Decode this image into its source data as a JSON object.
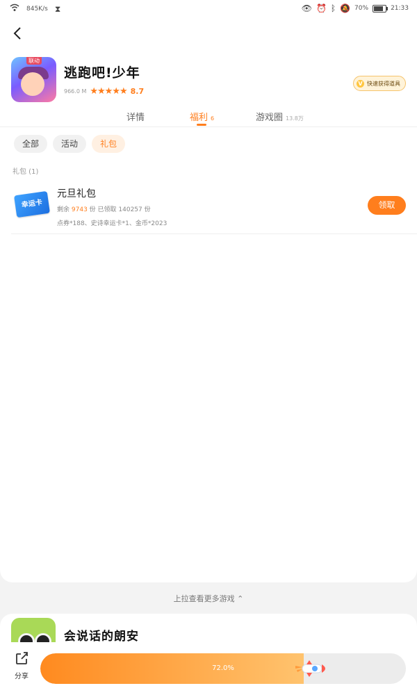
{
  "status_bar": {
    "net_speed": "845K/s",
    "battery": "70%",
    "time": "21:33"
  },
  "game": {
    "title": "逃跑吧!少年",
    "size": "966.0 M",
    "rating": "8.7",
    "rating_value": 4.5,
    "quick_tag": "快速获得道具",
    "icon_tag": "联动"
  },
  "tabs": [
    {
      "label": "详情",
      "count": ""
    },
    {
      "label": "福利",
      "count": "6"
    },
    {
      "label": "游戏圈",
      "count": "13.8万"
    }
  ],
  "chips": [
    "全部",
    "活动",
    "礼包"
  ],
  "section_label": "礼包 (1)",
  "gift": {
    "icon_text": "幸运卡",
    "title": "元旦礼包",
    "remain_prefix": "剩余",
    "remain": "9743",
    "remain_suffix": "份 已领取 140257 份",
    "desc": "点券*188、史诗幸运卡*1、金币*2023",
    "button": "领取"
  },
  "more_hint": "上拉查看更多游戏 ⌃",
  "next_game": {
    "title": "会说话的朗安"
  },
  "bottom": {
    "share_label": "分享",
    "progress": 72.0,
    "progress_text": "72.0%"
  },
  "colors": {
    "accent": "#ff7e1d"
  }
}
